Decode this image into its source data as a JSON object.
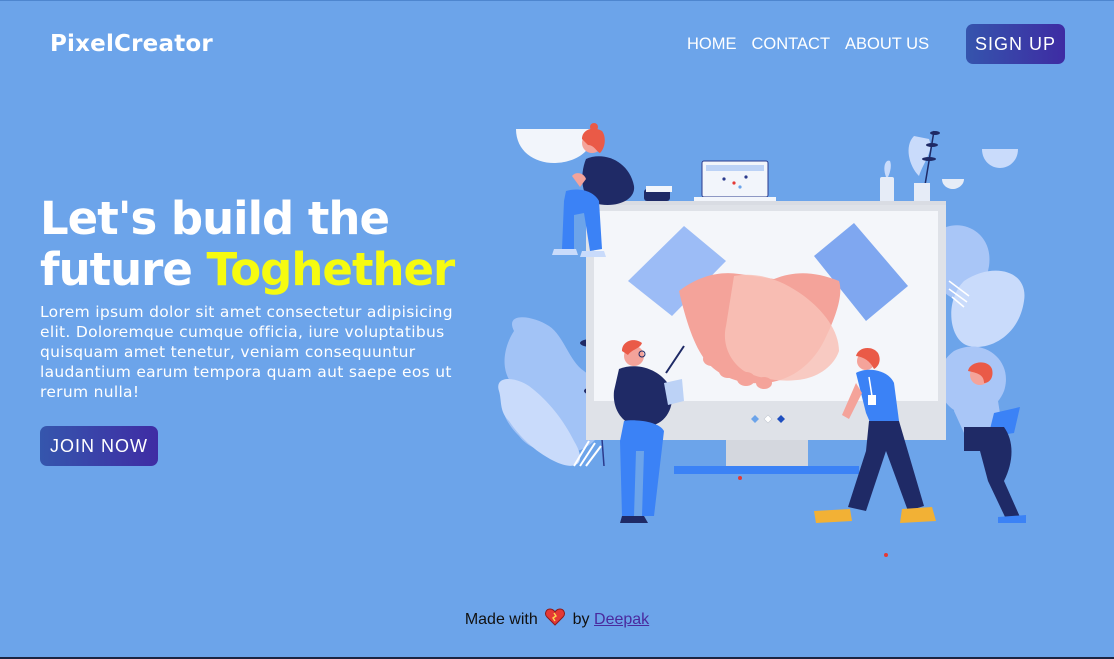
{
  "header": {
    "brand": "PixelCreator",
    "nav": [
      {
        "label": "HOME"
      },
      {
        "label": "CONTACT"
      },
      {
        "label": "ABOUT US"
      }
    ],
    "signup_label": "SIGN UP"
  },
  "hero": {
    "title_line1": "Let's build the",
    "title_line2_plain": "future ",
    "title_line2_highlight": "Toghether",
    "body": "Lorem ipsum dolor sit amet consectetur adipisicing elit. Doloremque cumque officia, iure voluptatibus quisquam amet tenetur, veniam consequuntur laudantium earum tempora quam aut saepe eos ut rerum nulla!",
    "cta_label": "JOIN NOW",
    "illustration_icon": "handshake-team-illustration"
  },
  "footer": {
    "prefix": "Made with",
    "heart_icon": "heart-icon",
    "by": "by",
    "author": "Deepak"
  },
  "colors": {
    "background": "#6ca4ea",
    "button_gradient_start": "#3554ad",
    "button_gradient_end": "#3e2ca3",
    "highlight": "#f6fb10"
  }
}
